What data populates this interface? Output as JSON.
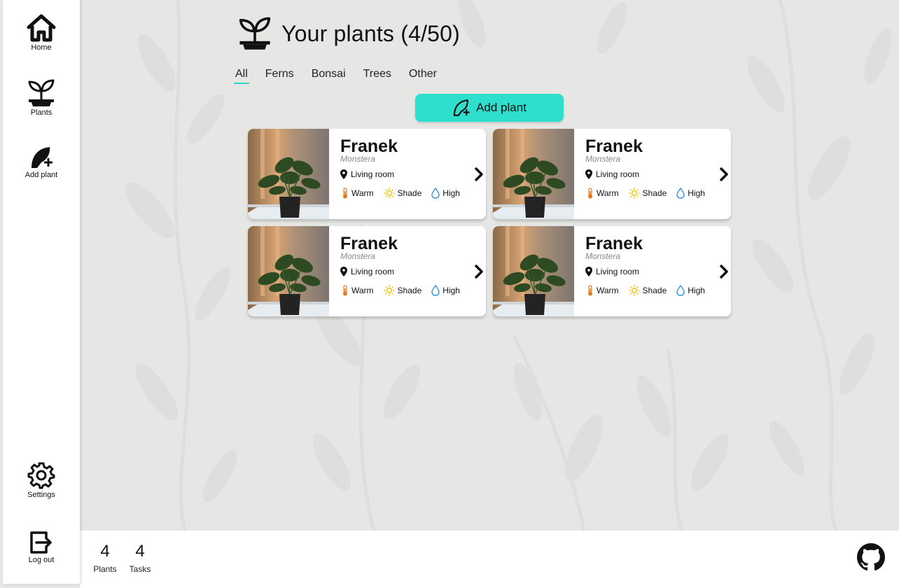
{
  "sidebar": {
    "items": [
      {
        "label": "Home",
        "icon": "home-icon"
      },
      {
        "label": "Plants",
        "icon": "sprout-icon"
      },
      {
        "label": "Add plant",
        "icon": "leaf-add-icon"
      },
      {
        "label": "Settings",
        "icon": "gear-icon"
      },
      {
        "label": "Log out",
        "icon": "logout-icon"
      }
    ]
  },
  "header": {
    "title": "Your plants (4/50)",
    "icon": "sprout-icon"
  },
  "tabs": [
    {
      "label": "All",
      "active": true
    },
    {
      "label": "Ferns",
      "active": false
    },
    {
      "label": "Bonsai",
      "active": false
    },
    {
      "label": "Trees",
      "active": false
    },
    {
      "label": "Other",
      "active": false
    }
  ],
  "add_button": {
    "label": "Add plant",
    "icon": "leaf-add-icon"
  },
  "plants": [
    {
      "name": "Franek",
      "species": "Monstera",
      "location": "Living room",
      "temperature": "Warm",
      "light": "Shade",
      "humidity": "High"
    },
    {
      "name": "Franek",
      "species": "Monstera",
      "location": "Living room",
      "temperature": "Warm",
      "light": "Shade",
      "humidity": "High"
    },
    {
      "name": "Franek",
      "species": "Monstera",
      "location": "Living room",
      "temperature": "Warm",
      "light": "Shade",
      "humidity": "High"
    },
    {
      "name": "Franek",
      "species": "Monstera",
      "location": "Living room",
      "temperature": "Warm",
      "light": "Shade",
      "humidity": "High"
    }
  ],
  "stats": {
    "plants": {
      "value": "4",
      "label": "Plants"
    },
    "tasks": {
      "value": "4",
      "label": "Tasks"
    }
  },
  "colors": {
    "accent": "#2fdfcd",
    "background": "#e6e7e5",
    "temperature_icon": "#e07a1f",
    "light_icon": "#f2c200",
    "humidity_icon": "#2f8fe0"
  }
}
